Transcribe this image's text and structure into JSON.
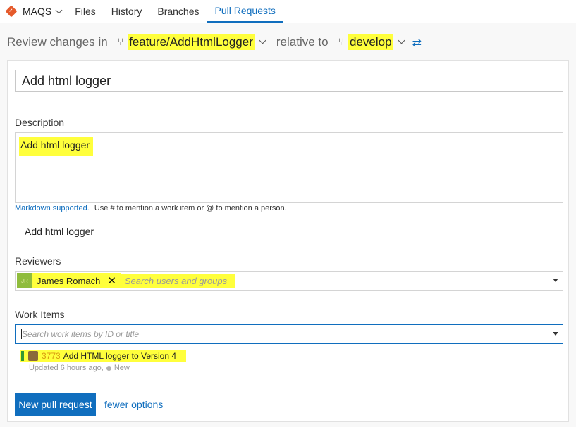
{
  "nav": {
    "repo": "MAQS",
    "tabs": [
      {
        "label": "Files"
      },
      {
        "label": "History"
      },
      {
        "label": "Branches"
      },
      {
        "label": "Pull Requests",
        "active": true
      }
    ]
  },
  "review": {
    "prefix": "Review changes in",
    "source_branch": "feature/AddHtmlLogger",
    "relative_text": "relative to",
    "target_branch": "develop"
  },
  "form": {
    "title_value": "Add html logger",
    "description_label": "Description",
    "description_value": "Add html logger",
    "markdown_link": "Markdown supported.",
    "markdown_hint": "Use # to mention a work item or @ to mention a person.",
    "preview_text": "Add html logger",
    "reviewers_label": "Reviewers",
    "reviewer": {
      "initials": "JR",
      "name": "James Romach"
    },
    "reviewers_placeholder": "Search users and groups",
    "work_items_label": "Work Items",
    "work_items_placeholder": "Search work items by ID or title",
    "work_item": {
      "id": "3773",
      "title": "Add HTML logger to Version 4",
      "updated": "Updated 6 hours ago,",
      "state": "New"
    },
    "submit_label": "New pull request",
    "fewer_options_label": "fewer options"
  },
  "colors": {
    "accent": "#106ebe",
    "highlight": "#ffff3c",
    "work_item_bar": "#339933"
  }
}
